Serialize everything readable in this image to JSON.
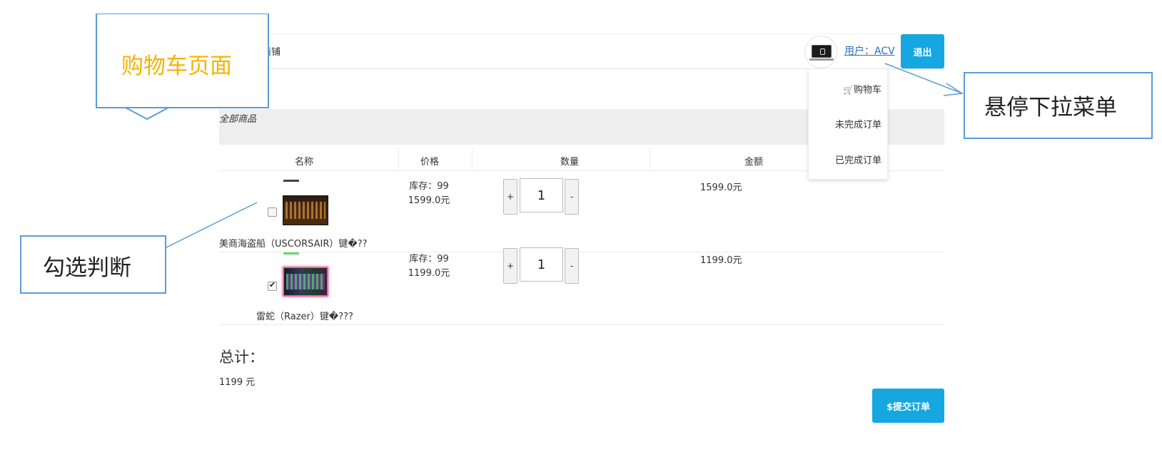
{
  "header": {
    "shop_name": "商铺",
    "user_link": "用户：ACV",
    "logout_label": "退出"
  },
  "dropdown": {
    "cart_label": "购物车",
    "pending_orders_label": "未完成订单",
    "completed_orders_label": "已完成订单"
  },
  "category": {
    "label": "全部商品"
  },
  "table": {
    "headers": [
      "名称",
      "价格",
      "数量",
      "金额"
    ],
    "rows": [
      {
        "name": "美商海盗船（USCORSAIR）键�??",
        "stock_label": "库存：99",
        "price": "1599.0元",
        "quantity": "1",
        "amount": "1599.0元",
        "checked": false
      },
      {
        "name": "雷蛇（Razer）键�???",
        "stock_label": "库存：99",
        "price": "1199.0元",
        "quantity": "1",
        "amount": "1199.0元",
        "checked": true
      }
    ],
    "plus_label": "+",
    "minus_label": "-"
  },
  "summary": {
    "total_label": "总计：",
    "total_value": "1199 元",
    "submit_label": "$提交订单"
  },
  "annotations": {
    "cart_page": "购物车页面",
    "hover_dropdown": "悬停下拉菜单",
    "check_judge": "勾选判断"
  },
  "colors": {
    "accent": "#16a6e0",
    "annotation_border": "#5b9bd5",
    "annotation_title": "#f4b400",
    "link": "#2a6ebb"
  }
}
